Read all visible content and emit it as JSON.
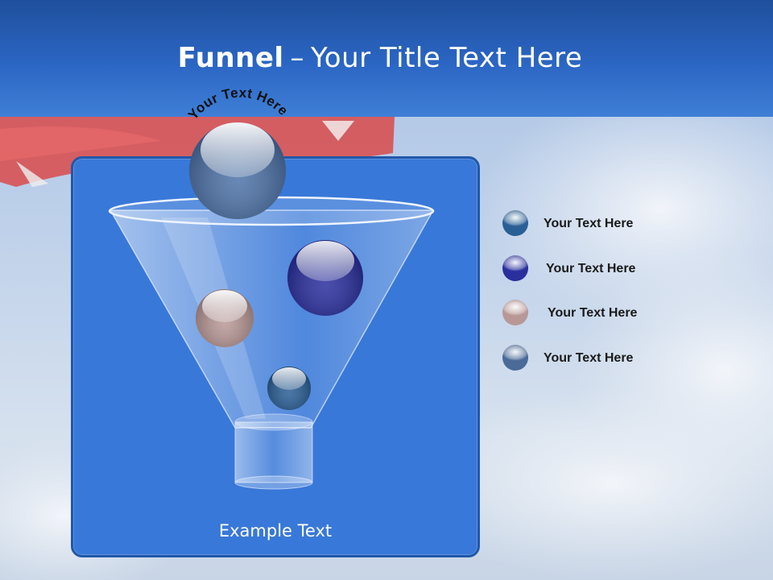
{
  "slide": {
    "title_bold": "Funnel",
    "title_dash": "–",
    "title_rest": "Your Title Text Here",
    "arc_text": "Your Text Here",
    "example_text": "Example Text"
  },
  "legend": [
    {
      "label": "Your  Text Here",
      "color": "#2a5f96"
    },
    {
      "label": "Your  Text Here",
      "color": "#2a2f9e"
    },
    {
      "label": "Your  Text Here",
      "color": "#b89896"
    },
    {
      "label": "Your  Text Here",
      "color": "#4a6a98"
    }
  ],
  "colors": {
    "header": "#2b66c4",
    "panel": "#3878d8",
    "panel_border": "#2258a8"
  }
}
